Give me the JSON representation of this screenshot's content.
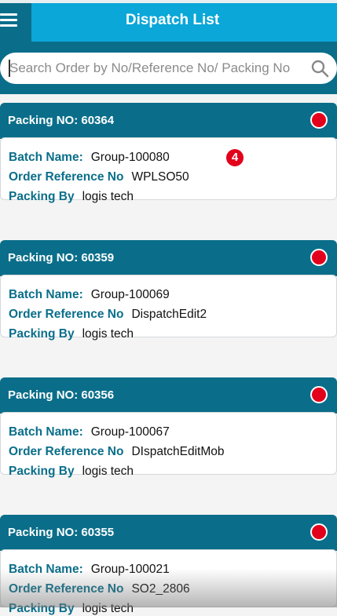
{
  "header": {
    "title": "Dispatch List"
  },
  "search": {
    "placeholder": "Search Order by No/Reference No/ Packing No",
    "value": ""
  },
  "labels": {
    "batch_name": "Batch Name:",
    "order_reference": "Order Reference No",
    "packing_by": "Packing By"
  },
  "notification_badge": "4",
  "colors": {
    "primary": "#0a6e8a",
    "header_accent": "#0aa7d8",
    "status": "#e3001b"
  },
  "cards": [
    {
      "title": "Packing NO: 60364",
      "batch_name": "Group-100080",
      "order_reference": "WPLSO50",
      "packing_by": "logis tech"
    },
    {
      "title": "Packing NO: 60359",
      "batch_name": "Group-100069",
      "order_reference": "DispatchEdit2",
      "packing_by": "logis tech"
    },
    {
      "title": "Packing NO: 60356",
      "batch_name": "Group-100067",
      "order_reference": "DIspatchEditMob",
      "packing_by": "logis tech"
    },
    {
      "title": "Packing NO: 60355",
      "batch_name": "Group-100021",
      "order_reference": "SO2_2806",
      "packing_by": "logis tech"
    }
  ]
}
